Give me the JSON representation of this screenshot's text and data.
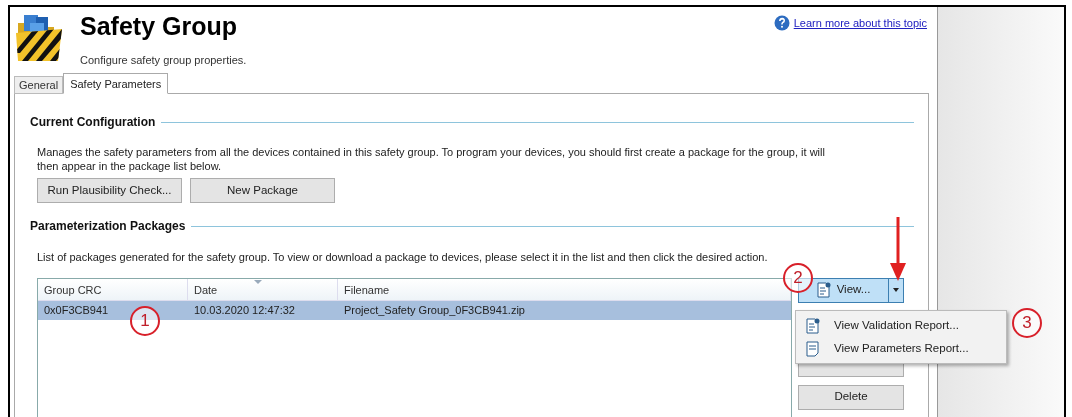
{
  "header": {
    "title": "Safety Group",
    "subtitle": "Configure safety group properties.",
    "help_link": "Learn more about this topic"
  },
  "tabs": [
    {
      "label": "General",
      "selected": false
    },
    {
      "label": "Safety Parameters",
      "selected": true
    }
  ],
  "current_configuration": {
    "heading": "Current Configuration",
    "description": "Manages the safety parameters from all the devices contained in this safety group.  To program your devices, you should first create a package for the group, it will then appear in the package list below.",
    "buttons": [
      "Run Plausibility Check...",
      "New Package"
    ]
  },
  "packages": {
    "heading": "Parameterization Packages",
    "description": "List of packages generated for the safety group.  To view or download a package to devices, please select it in the list and then click the desired action.",
    "columns": [
      "Group CRC",
      "Date",
      "Filename"
    ],
    "rows": [
      {
        "cells": [
          "0x0F3CB941",
          "10.03.2020 12:47:32",
          "Project_Safety Group_0F3CB941.zip"
        ],
        "selected": true
      }
    ],
    "view_button": {
      "label": "View...",
      "expanded": true
    },
    "delete_button": "Delete",
    "menu": [
      {
        "label": "View Validation Report...",
        "kind": "validation"
      },
      {
        "label": "View Parameters Report...",
        "kind": "parameters"
      }
    ]
  },
  "annotations": [
    {
      "label": "1"
    },
    {
      "label": "2"
    },
    {
      "label": "3"
    }
  ]
}
